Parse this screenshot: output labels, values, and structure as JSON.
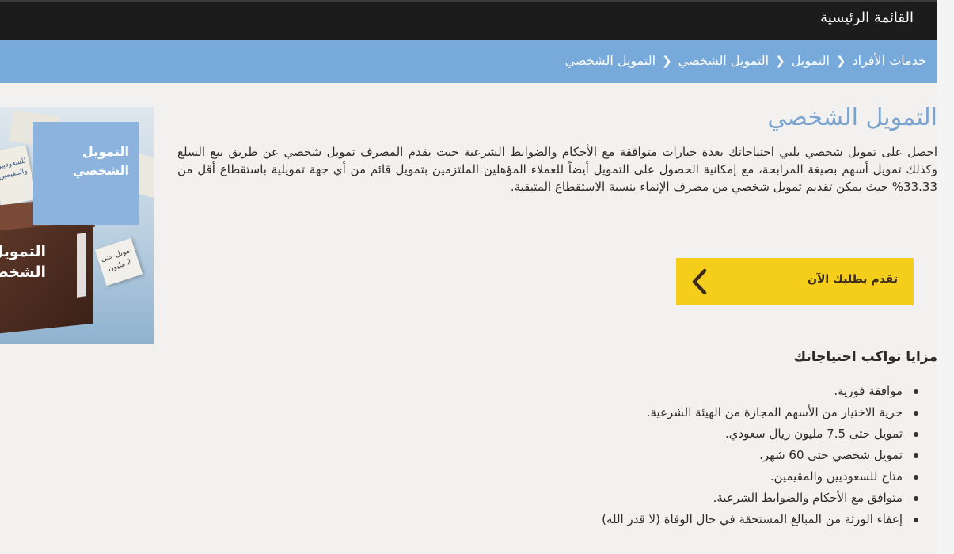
{
  "topbar": {
    "menu_label": "القائمة الرئيسية"
  },
  "breadcrumb": {
    "items": [
      "خدمات الأفراد",
      "التمويل",
      "التمويل الشخصي",
      "التمويل الشخصي"
    ],
    "separator_icon": "chevron-icon"
  },
  "main": {
    "title": "التمويل الشخصي",
    "description": "احصل على تمويل شخصي يلبي احتياجاتك بعدة خيارات متوافقة مع الأحكام والضوابط الشرعية حيث يقدم المصرف تمويل شخصي عن طريق بيع السلع وكذلك تمويل أسهم بصيغة المرابحة، مع إمكانية الحصول على التمويل أيضاً للعملاء المؤهلين الملتزمين بتمويل قائم من أي جهة تمويلية باستقطاع أقل من 33.33% حيث يمكن تقديم تمويل شخصي من مصرف الإنماء بنسبة الاستقطاع المتبقية."
  },
  "promo_image": {
    "blue_text": "التمويل الشخصي",
    "box_text": "التمويل الشخصي",
    "cube_left_text": "للسعوديين والمقيمين",
    "cube_small_text": "تمويل حتى 2 مليون"
  },
  "apply_button": {
    "label": "تقدم بطلبك الآن",
    "icon": "chevron-left-icon"
  },
  "features": {
    "heading": "مزايا تواكب احتياجاتك",
    "items": [
      "موافقة فورية.",
      "حرية الاختيار من الأسهم المجازة من الهيئة الشرعية.",
      "تمويل حتى 7.5 مليون ريال سعودي.",
      "تمويل شخصي حتى 60 شهر.",
      "متاح للسعوديين والمقيمين.",
      "متوافق مع الأحكام والضوابط الشرعية.",
      "إعفاء الورثة من المبالغ المستحقة في حال الوفاة (لا قدر الله)"
    ]
  },
  "colors": {
    "topbar": "#1c1c1c",
    "breadcrumb_bar": "#78a9db",
    "title": "#7aa4cf",
    "button": "#f5ce1c",
    "page_bg": "#f3f1ef"
  }
}
